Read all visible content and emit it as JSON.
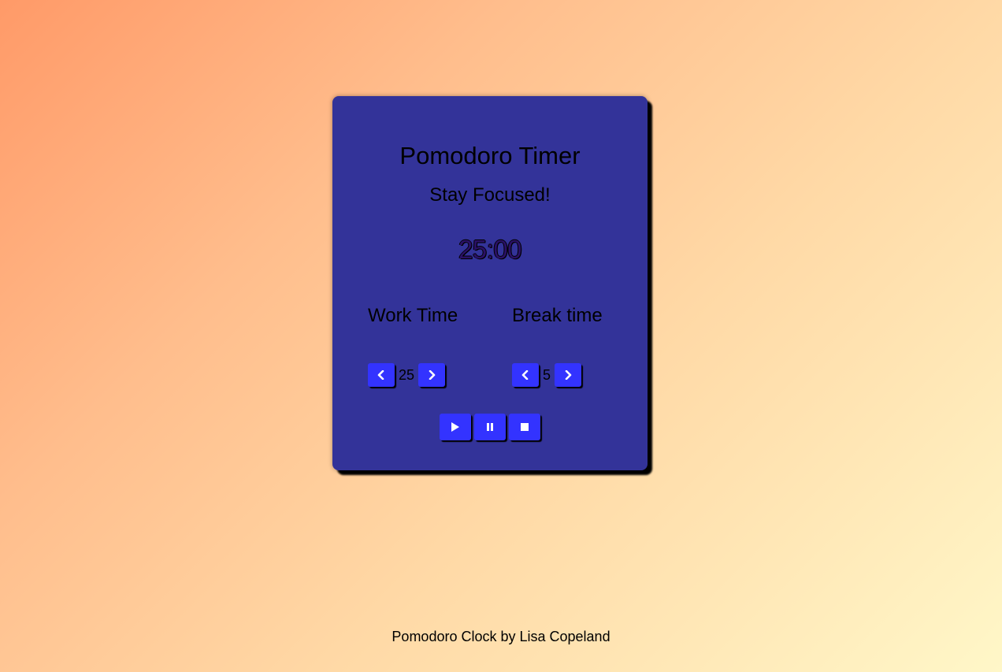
{
  "card": {
    "title": "Pomodoro Timer",
    "subtitle": "Stay Focused!",
    "time": "25:00"
  },
  "work": {
    "label": "Work Time",
    "value": "25"
  },
  "break": {
    "label": "Break time",
    "value": "5"
  },
  "icons": {
    "decrement": "chevron-left-icon",
    "increment": "chevron-right-icon",
    "play": "play-icon",
    "pause": "pause-icon",
    "stop": "stop-icon"
  },
  "colors": {
    "card": "#333399",
    "button": "#3333ff"
  },
  "footer": {
    "text": "Pomodoro Clock by Lisa Copeland"
  }
}
